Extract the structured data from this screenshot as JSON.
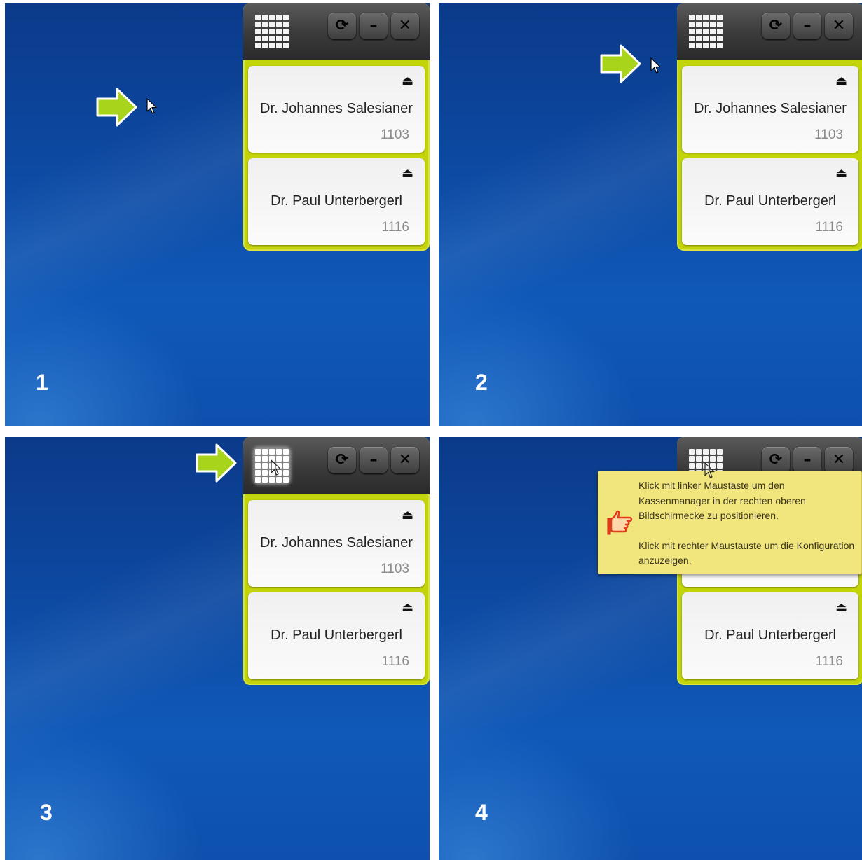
{
  "panels": [
    {
      "step": "1"
    },
    {
      "step": "2"
    },
    {
      "step": "3"
    },
    {
      "step": "4"
    }
  ],
  "widget": {
    "grid_icon": "grid-icon",
    "refresh_icon": "refresh-icon",
    "minimize_icon": "minimize-icon",
    "close_icon": "close-icon",
    "refresh_glyph": "⟳",
    "minimize_glyph": "–",
    "close_glyph": "✕",
    "eject_glyph": "⏏",
    "cards": [
      {
        "name": "Dr. Johannes Salesianer",
        "extension": "1103"
      },
      {
        "name": "Dr. Paul Unterbergerl",
        "extension": "1116"
      }
    ],
    "header_color": "#3a3a3a",
    "accent_color": "#c4d40a"
  },
  "tooltip": {
    "icon": "pointing-hand-icon",
    "line_left": "Klick mit linker Maustaste um den Kassenmanager in der rechten oberen Bildschirmecke zu positionieren.",
    "line_right": "Klick mit rechter Maustauste um die Konfiguration anzuzeigen."
  },
  "desktop_color": "#0d4aa3",
  "arrow_color": "#a8d41c"
}
